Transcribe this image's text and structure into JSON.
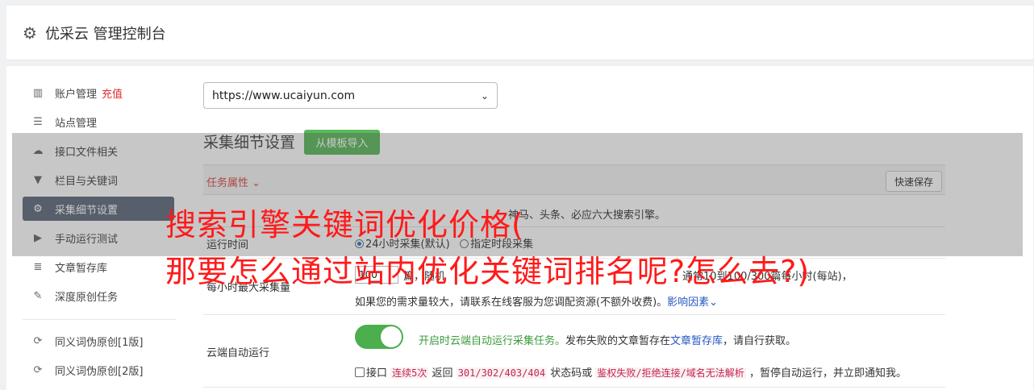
{
  "header": {
    "icon": "gear-icon",
    "title": "优采云 管理控制台"
  },
  "sidebar": {
    "items": [
      {
        "icon": "bar-chart-icon",
        "label": "账户管理",
        "extra": "充值"
      },
      {
        "icon": "server-icon",
        "label": "站点管理"
      },
      {
        "icon": "cloud-upload-icon",
        "label": "接口文件相关"
      },
      {
        "icon": "filter-icon",
        "label": "栏目与关键词"
      },
      {
        "icon": "cogs-icon",
        "label": "采集细节设置"
      },
      {
        "icon": "play-circle-icon",
        "label": "手动运行测试"
      },
      {
        "icon": "database-icon",
        "label": "文章暂存库"
      },
      {
        "icon": "edit-icon",
        "label": "深度原创任务"
      },
      {
        "icon": "refresh-icon",
        "label": "同义词伪原创[1版]"
      },
      {
        "icon": "refresh-icon",
        "label": "同义词伪原创[2版]"
      }
    ],
    "active_index": 4
  },
  "site_select": {
    "value": "https://www.ucaiyun.com"
  },
  "section": {
    "title": "采集细节设置",
    "import_button": "从模板导入"
  },
  "props_bar": {
    "tab": "任务属性",
    "save_button": "快速保存"
  },
  "rows": {
    "engines_text": "神马、头条、必应六大搜索引擎。",
    "run_time": {
      "label": "运行时间",
      "option1": "24小时采集(默认)",
      "option2": "指定时段采集"
    },
    "max_per_hour": {
      "label": "每小时最大采集量",
      "value": "100",
      "line1a": "篇，随机",
      "line1b": "通常10到100/300篇每小时(每站)，",
      "line2": "如果您的需求量较大，请联系在线客服为您调配资源(不额外收费)。",
      "link": "影响因素"
    },
    "cloud_run": {
      "label": "云端自动运行",
      "toggle_text": "开启时云端自动运行采集任务。",
      "desc1": "发布失败的文章暂存在",
      "link": "文章暂存库",
      "desc2": "，请自行获取。",
      "chk_label": "接口",
      "code1": "连续5次",
      "t1": "返回",
      "code2": "301/302/403/404",
      "t2": "状态码或",
      "code3": "鉴权失败/拒绝连接/域名无法解析",
      "t3": "，暂停自动运行，并立即通知我。"
    }
  },
  "overlay_headline": {
    "line1": "搜索引擎关键词优化价格(",
    "line2": "那要怎么通过站内优化关键词排名呢?怎么去?)"
  },
  "colors": {
    "accent_green": "#5cb85c",
    "headline_red": "#ff1a1a",
    "active_sidebar": "#5d6b7c"
  }
}
